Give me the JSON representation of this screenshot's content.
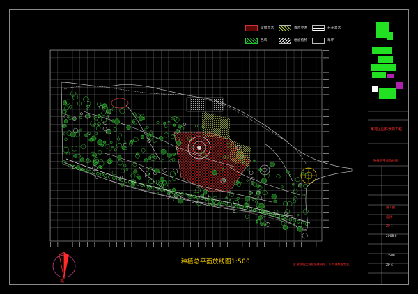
{
  "drawing": {
    "scale_title": "种植总平面放线图1:500",
    "note": "注:放线施工前应复核现场，以实测数据为准。",
    "north_label": "北"
  },
  "legend": {
    "items": [
      {
        "label": "常绿乔木",
        "color": "#d0303a"
      },
      {
        "label": "落叶乔木",
        "color": "#b8d040"
      },
      {
        "label": "开花灌木",
        "color": "#ffffff"
      },
      {
        "label": "色块",
        "color": "#22c833"
      },
      {
        "label": "地被植物",
        "color": "#ffffff"
      },
      {
        "label": "草坪",
        "color": "#ffffff"
      }
    ]
  },
  "title_block": {
    "project_name": "某地区园林景观工程",
    "drawing_name": "种植总平面放线图",
    "stage_label": "施工图",
    "design_label": "设计",
    "drawing_no": "ZP-1",
    "date": "2008.6",
    "scale": "1:500",
    "sheet": "ZP-6"
  },
  "colors": {
    "grid": "#9a9a9a",
    "tree": "#3cd23c",
    "path": "#d0d0d0",
    "plaza": "#9aa8a0",
    "red": "#ff2a2a",
    "yellow": "#ffd400"
  }
}
